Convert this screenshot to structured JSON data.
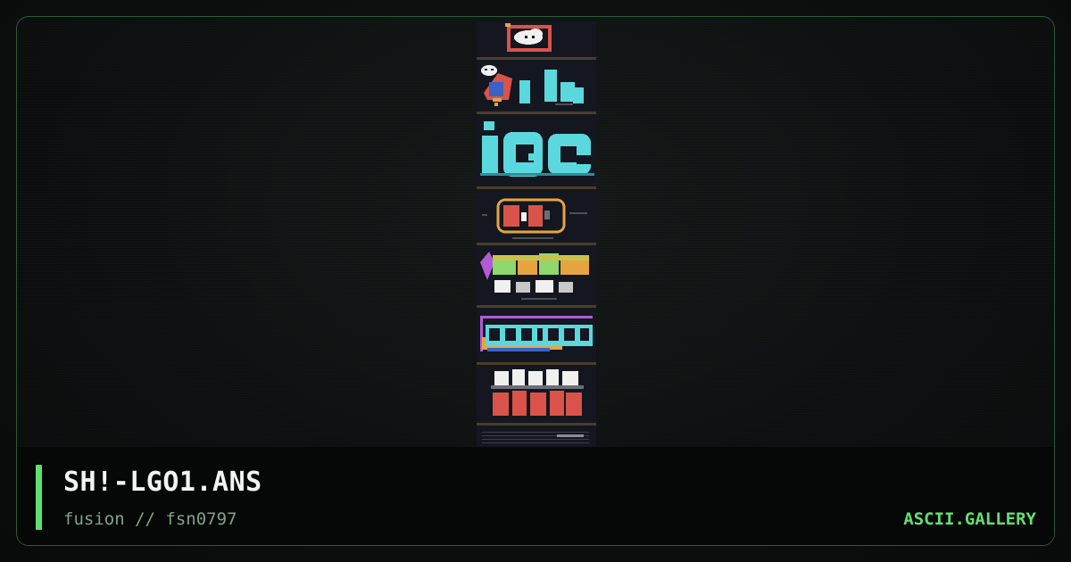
{
  "card": {
    "title": "SH!-LGO1.ANS",
    "subtitle": "fusion // fsn0797",
    "brand": "ASCII.GALLERY"
  },
  "artwork": {
    "content": "ANSI art preview image",
    "colors": {
      "background": "#14171f",
      "divider": "#4a3e2a",
      "cyan": "#5ad8de",
      "red": "#d9534a",
      "orange": "#e6a440",
      "purple": "#b35ad8",
      "green": "#8fd86b",
      "white": "#f0f0f0",
      "blue": "#3a62c8"
    }
  },
  "theme": {
    "accent": "#5fe070",
    "border": "#2c5a37",
    "brand_color": "#63e070",
    "subtitle_color": "#7fa386"
  }
}
